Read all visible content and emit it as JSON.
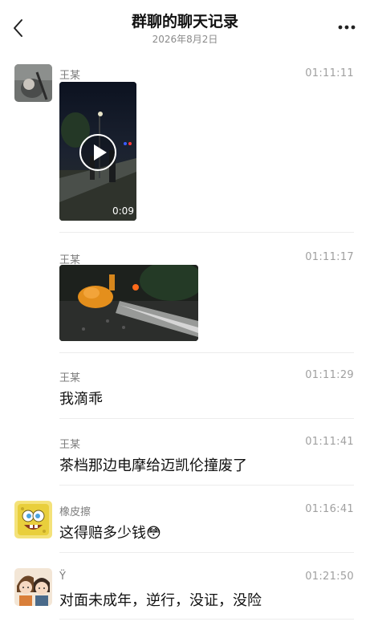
{
  "header": {
    "title": "群聊的聊天记录",
    "date": "2026年8月2日",
    "back_icon": "chevron-left-icon",
    "more_icon": "more-dots-icon"
  },
  "messages": [
    {
      "sender": "王某",
      "time": "01:11:11",
      "type": "video",
      "duration": "0:09",
      "play_icon": "play-icon"
    },
    {
      "sender": "王某",
      "time": "01:11:17",
      "type": "image"
    },
    {
      "sender": "王某",
      "time": "01:11:29",
      "type": "text",
      "text": "我滴乖"
    },
    {
      "sender": "王某",
      "time": "01:11:41",
      "type": "text",
      "text": "茶档那边电摩给迈凯伦撞废了"
    },
    {
      "sender": "橡皮擦",
      "time": "01:16:41",
      "type": "text",
      "text": "这得赔多少钱",
      "emoji": "😳"
    },
    {
      "sender": "Ÿ",
      "time": "01:21:50",
      "type": "text",
      "text": "对面未成年，逆行，没证，没险"
    }
  ]
}
